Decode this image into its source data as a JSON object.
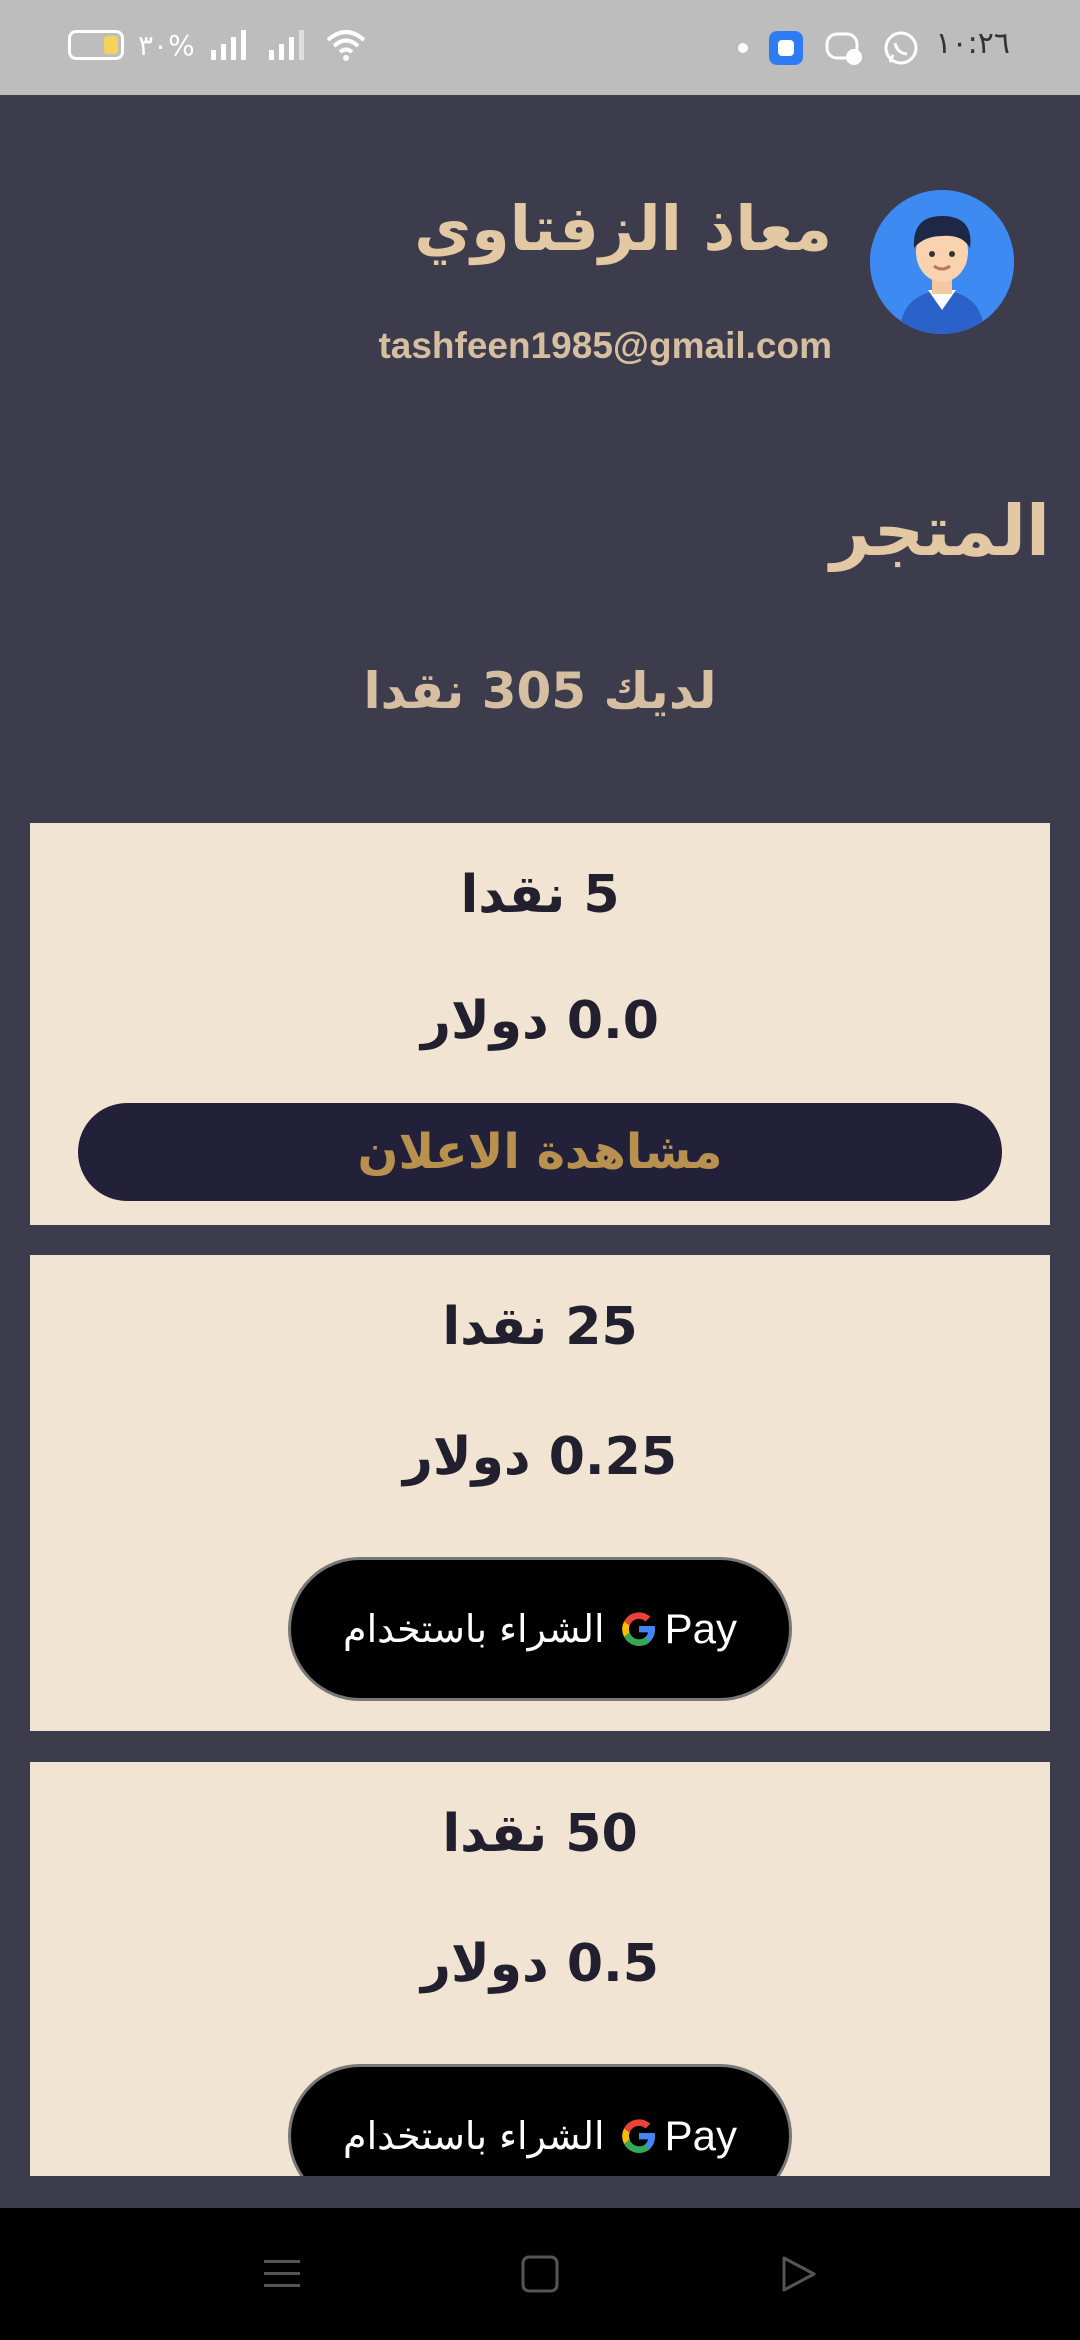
{
  "status_bar": {
    "time": "١٠:٢٦",
    "battery_percent": "٣٠%",
    "icons": [
      "whatsapp-icon",
      "messenger-icon",
      "app-icon",
      "dot-icon",
      "wifi-icon",
      "signal-icon",
      "signal-icon",
      "battery-icon"
    ]
  },
  "profile": {
    "name": "معاذ الزفتاوي",
    "email": "tashfeen1985@gmail.com",
    "avatar_icon": "user-avatar-icon"
  },
  "store": {
    "title": "المتجر",
    "balance_text": "لديك 305 نقدا"
  },
  "packages": [
    {
      "coins": "5 نقدا",
      "price": "0.0 دولار",
      "action": "مشاهدة الاعلان",
      "action_type": "watch-ad"
    },
    {
      "coins": "25 نقدا",
      "price": "0.25 دولار",
      "action": "الشراء باستخدام",
      "action_type": "google-pay"
    },
    {
      "coins": "50 نقدا",
      "price": "0.5 دولار",
      "action": "الشراء باستخدام",
      "action_type": "google-pay"
    }
  ],
  "gpay": {
    "pay_label": "Pay"
  },
  "colors": {
    "background": "#3d3c4d",
    "card": "#f2e4d2",
    "accent_text": "#e2c9a4",
    "ad_button": "#23213a",
    "ad_button_text": "#b9914f"
  },
  "nav": [
    "menu-icon",
    "home-icon",
    "back-icon"
  ]
}
